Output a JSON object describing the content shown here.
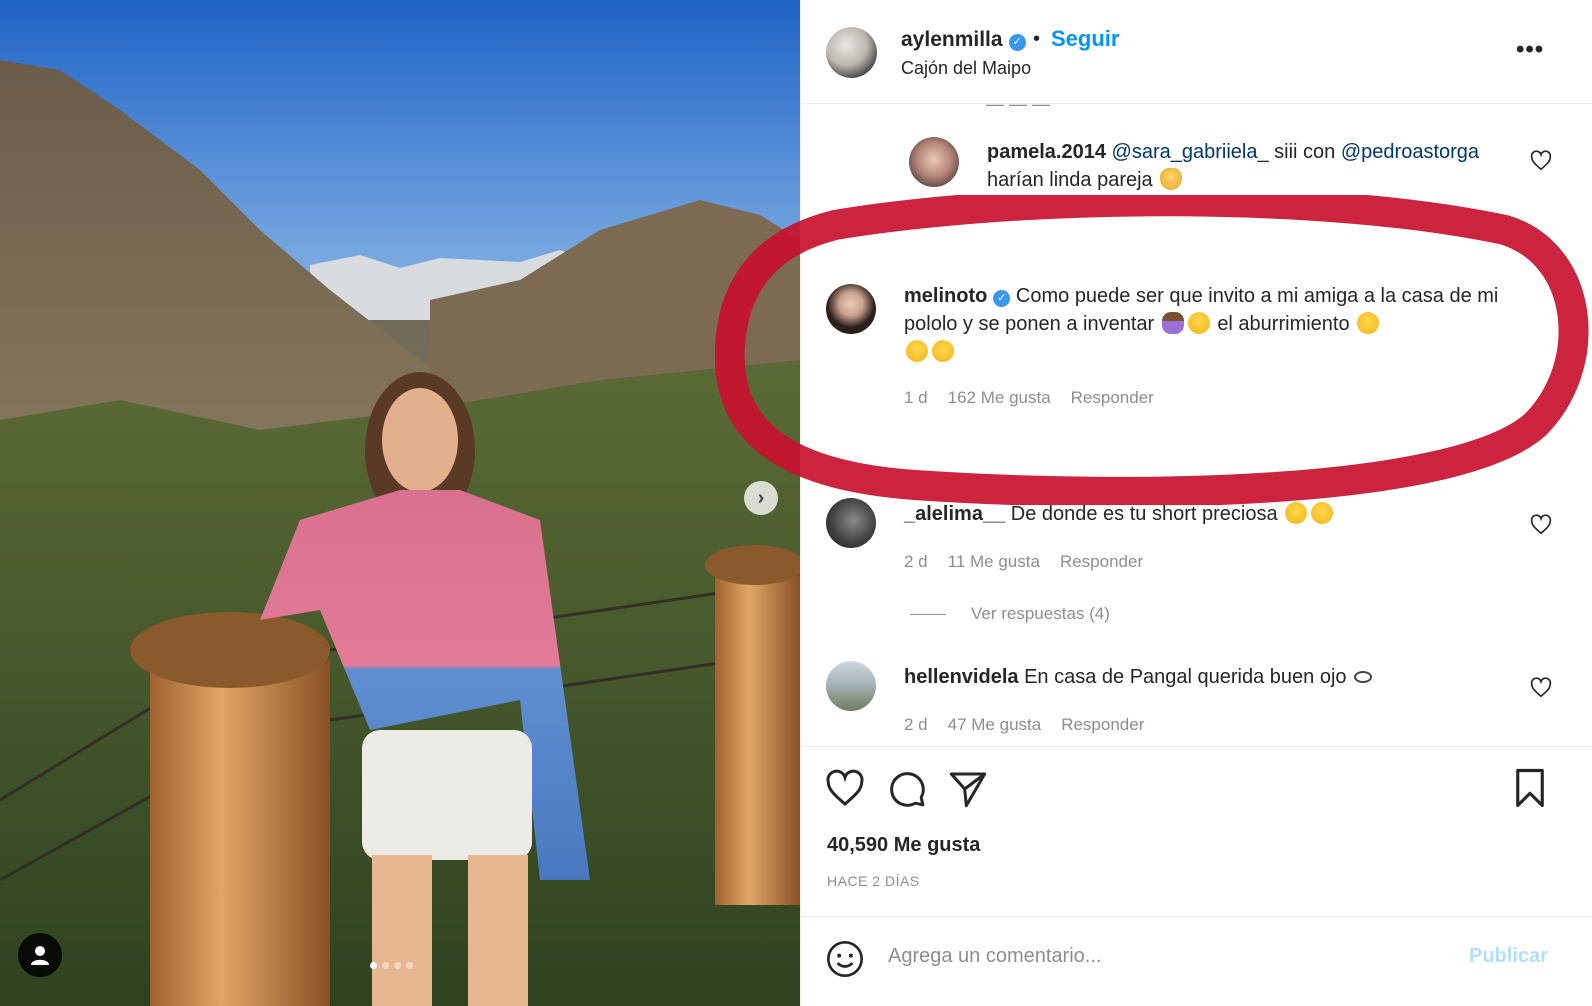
{
  "post": {
    "username": "aylenmilla",
    "follow_label": "Seguir",
    "separator": "•",
    "location": "Cajón del Maipo",
    "more_label": "•••",
    "likes": "40,590 Me gusta",
    "time_ago": "HACE 2 DÍAS",
    "photo_slides": 4,
    "active_slide": 0
  },
  "comments": [
    {
      "username": "pamela.2014",
      "mention1": "@sara_gabriiela_",
      "text1": " siii con ",
      "mention2": "@pedroastorga",
      "text2": "harían linda pareja"
    },
    {
      "username": "melinoto",
      "verified": true,
      "text": "Como puede ser que invito a mi amiga a la casa de mi pololo y se ponen a inventar",
      "text_after": "el aburrimiento",
      "age": "1 d",
      "likes": "162 Me gusta",
      "reply": "Responder"
    },
    {
      "username": "_alelima__",
      "text": "De donde es tu short preciosa",
      "age": "2 d",
      "likes": "11 Me gusta",
      "reply": "Responder",
      "view_replies": "Ver respuestas (4)"
    },
    {
      "username": "hellenvidela",
      "text": "En casa de Pangal querida buen ojo",
      "age": "2 d",
      "likes": "47 Me gusta",
      "reply": "Responder"
    }
  ],
  "composer": {
    "placeholder": "Agrega un comentario...",
    "publish_label": "Publicar"
  },
  "colors": {
    "link_blue": "#0095f6",
    "verified_blue": "#3897f0",
    "muted_text": "#8e8e8e",
    "annotation_red": "#c8102e"
  }
}
